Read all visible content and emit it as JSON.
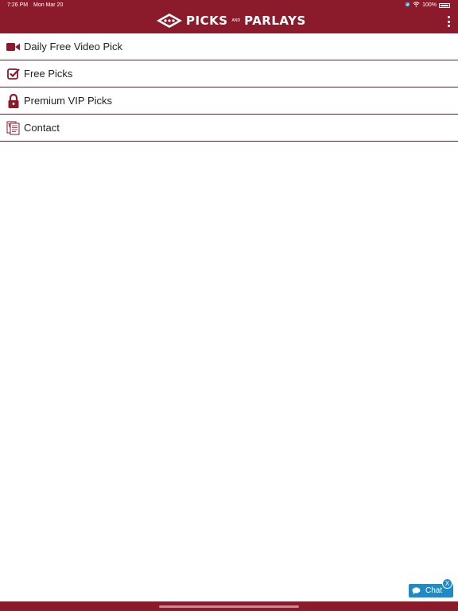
{
  "status_bar": {
    "time": "7:26 PM",
    "date": "Mon Mar 20",
    "battery": "100%"
  },
  "header": {
    "logo_text_left": "PICKS",
    "logo_text_and": "AND",
    "logo_text_right": "PARLAYS",
    "brand_color": "#8b1a2b"
  },
  "menu": {
    "items": [
      {
        "label": "Daily Free Video Pick",
        "icon": "video-camera-icon"
      },
      {
        "label": "Free Picks",
        "icon": "checkbox-icon"
      },
      {
        "label": "Premium VIP Picks",
        "icon": "lock-icon"
      },
      {
        "label": "Contact",
        "icon": "contact-document-icon"
      }
    ]
  },
  "chat": {
    "label": "Chat",
    "close_label": "X",
    "color": "#1f8bc6"
  }
}
